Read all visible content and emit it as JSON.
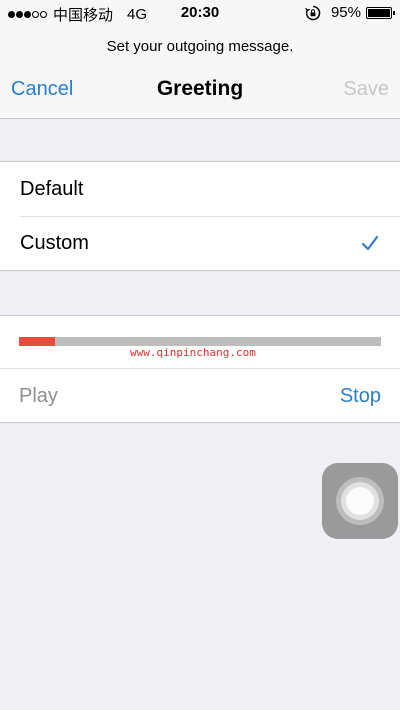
{
  "status_bar": {
    "signal_dots_total": 5,
    "signal_dots_filled": 3,
    "carrier": "中国移动",
    "network": "4G",
    "time": "20:30",
    "battery_percent": "95%"
  },
  "header": {
    "prompt": "Set your outgoing message.",
    "title": "Greeting",
    "cancel_label": "Cancel",
    "save_label": "Save"
  },
  "options": {
    "items": [
      {
        "label": "Default",
        "selected": false
      },
      {
        "label": "Custom",
        "selected": true
      }
    ]
  },
  "recording": {
    "progress": 0.1,
    "watermark": "www.qinpinchang.com",
    "play_label": "Play",
    "stop_label": "Stop"
  },
  "colors": {
    "accent": "#2b7fc8",
    "progress_fill": "#e74c3c",
    "progress_track": "#bdbdbd",
    "disabled": "#c7c7cc",
    "background": "#efeff4"
  },
  "icons": {
    "checkmark": "checkmark-icon",
    "orientation_lock": "orientation-lock-icon",
    "battery": "battery-icon",
    "assistive_touch": "assistive-touch-button"
  }
}
